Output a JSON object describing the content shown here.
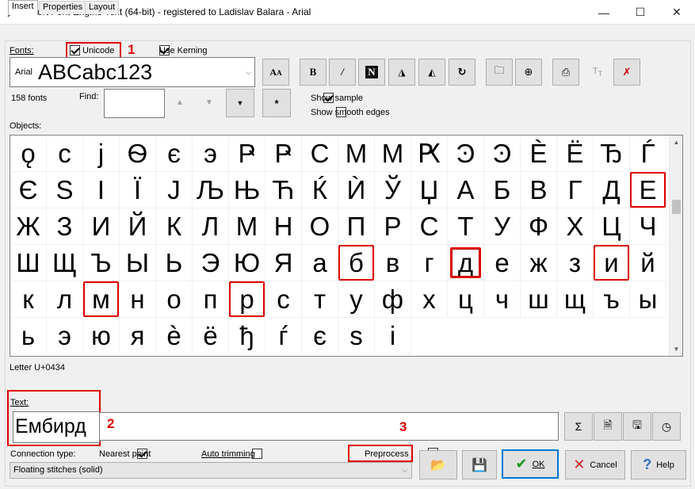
{
  "window": {
    "title": "Insert Font Engine Text (64-bit) - registered to Ladislav Balara - Arial",
    "minimize": "—",
    "maximize": "☐",
    "close": "✕"
  },
  "tabs": [
    {
      "label": "Insert",
      "active": true
    },
    {
      "label": "Properties",
      "active": false
    },
    {
      "label": "Layout",
      "active": false
    }
  ],
  "fonts": {
    "label": "Fonts:",
    "unicode_label": "Unicode",
    "unicode_checked": true,
    "kerning_label": "Use Kerning",
    "kerning_checked": true,
    "font_name": "Arial",
    "font_sample": "ABCabc123",
    "count": "158 fonts",
    "find_label": "Find:",
    "find_value": "",
    "star_button": "*"
  },
  "options": {
    "show_sample_label": "Show sample",
    "show_sample_checked": true,
    "show_smooth_label": "Show smooth edges",
    "show_smooth_checked": false
  },
  "toolbar_icons": [
    "font-size-icon",
    "bold-icon",
    "italic-icon",
    "outline-n-icon",
    "mirror-horizontal-icon",
    "mirror-vertical-icon",
    "rotate-icon",
    "folder-icon",
    "zoom-icon",
    "print-icon",
    "text-size-icon",
    "running-man-icon"
  ],
  "objects": {
    "label": "Objects:",
    "rows": [
      [
        "ǫ",
        "с",
        "ј",
        "Ѳ",
        "є",
        "э",
        "Ҏ",
        "Ҏ",
        "С",
        "М",
        "М",
        "Ԗ",
        "Ͽ",
        "Ͽ",
        "Ѐ",
        "Ё"
      ],
      [
        "Ђ",
        "Ѓ",
        "Є",
        "Ѕ",
        "І",
        "Ї",
        "Ј",
        "Љ",
        "Њ",
        "Ћ",
        "Ќ",
        "Ѝ",
        "Ў",
        "Џ",
        "А",
        "Б",
        "В"
      ],
      [
        "Г",
        "Д",
        "Е",
        "Ж",
        "З",
        "И",
        "Й",
        "К",
        "Л",
        "М",
        "Н",
        "О",
        "П",
        "Р",
        "С",
        "Т",
        "У"
      ],
      [
        "Ф",
        "Х",
        "Ц",
        "Ч",
        "Ш",
        "Щ",
        "Ъ",
        "Ы",
        "Ь",
        "Э",
        "Ю",
        "Я",
        "а",
        "б",
        "в",
        "г",
        "д"
      ],
      [
        "е",
        "ж",
        "з",
        "и",
        "й",
        "к",
        "л",
        "м",
        "н",
        "о",
        "п",
        "р",
        "с",
        "т",
        "у",
        "ф",
        "х"
      ],
      [
        "ц",
        "ч",
        "ш",
        "щ",
        "ъ",
        "ы",
        "ь",
        "э",
        "ю",
        "я",
        "ѐ",
        "ё",
        "ђ",
        "ѓ",
        "є",
        "ѕ",
        "і"
      ]
    ],
    "status": "Letter U+0434"
  },
  "text": {
    "label": "Text:",
    "value": "Ембирд"
  },
  "annotations": {
    "n1": "1",
    "n2": "2",
    "n3": "3"
  },
  "connection": {
    "label": "Connection type:",
    "nearest_label": "Nearest point",
    "nearest_checked": true,
    "auto_label": "Auto trimming",
    "auto_checked": false,
    "preprocess_label": "Preprocess",
    "preprocess_checked": true,
    "selected": "Floating stitches (solid)"
  },
  "buttons": {
    "ok": "OK",
    "cancel": "Cancel",
    "help": "Help"
  },
  "colors": {
    "accent_red": "#e00000",
    "ok_green": "#1a9a1a",
    "cancel_red": "#d42020",
    "help_blue": "#2f6fc4"
  }
}
